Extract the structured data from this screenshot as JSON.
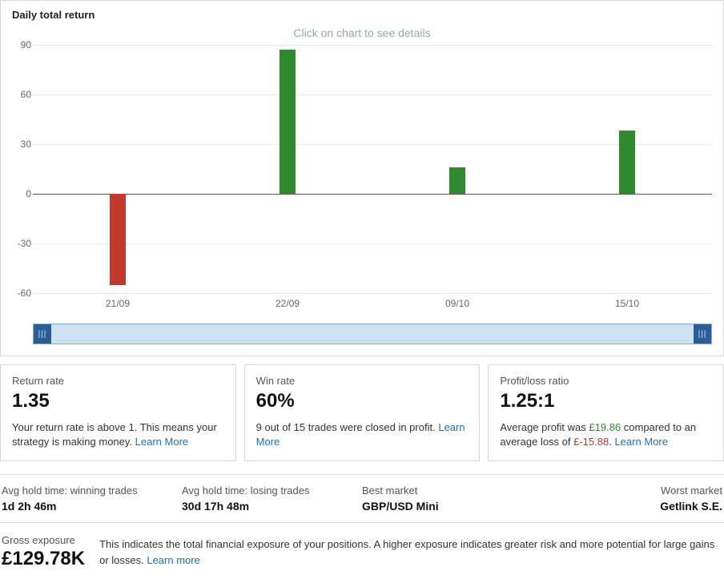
{
  "chart_data": {
    "type": "bar",
    "title": "Daily total return",
    "hint": "Click on chart to see details",
    "categories": [
      "21/09",
      "22/09",
      "09/10",
      "15/10"
    ],
    "values": [
      -55,
      87,
      16,
      38
    ],
    "ylim": [
      -60,
      90
    ],
    "yticks": [
      -60,
      -30,
      0,
      30,
      60,
      90
    ],
    "xlabel": "",
    "ylabel": ""
  },
  "cards": {
    "return_rate": {
      "label": "Return rate",
      "value": "1.35",
      "desc_prefix": "Your return rate is above 1. This means your strategy is making money. ",
      "learn_more": "Learn More"
    },
    "win_rate": {
      "label": "Win rate",
      "value": "60%",
      "desc_prefix": "9 out of 15 trades were closed in profit. ",
      "learn_more": "Learn More"
    },
    "pl_ratio": {
      "label": "Profit/loss ratio",
      "value": "1.25:1",
      "desc_p1": "Average profit was ",
      "profit": "£19.86",
      "desc_p2": " compared to an average loss of ",
      "loss": "£-15.88",
      "desc_p3": ". ",
      "learn_more": "Learn More"
    }
  },
  "stats": {
    "win_hold": {
      "label": "Avg hold time: winning trades",
      "value": "1d 2h 46m"
    },
    "lose_hold": {
      "label": "Avg hold time: losing trades",
      "value": "30d 17h 48m"
    },
    "best_market": {
      "label": "Best market",
      "value": "GBP/USD Mini"
    },
    "worst_market": {
      "label": "Worst market",
      "value": "Getlink S.E."
    }
  },
  "exposure": {
    "label": "Gross exposure",
    "value": "£129.78K",
    "desc_prefix": "This indicates the total financial exposure of your positions. A higher exposure indicates greater risk and more potential for large gains or losses. ",
    "learn_more": "Learn more"
  }
}
